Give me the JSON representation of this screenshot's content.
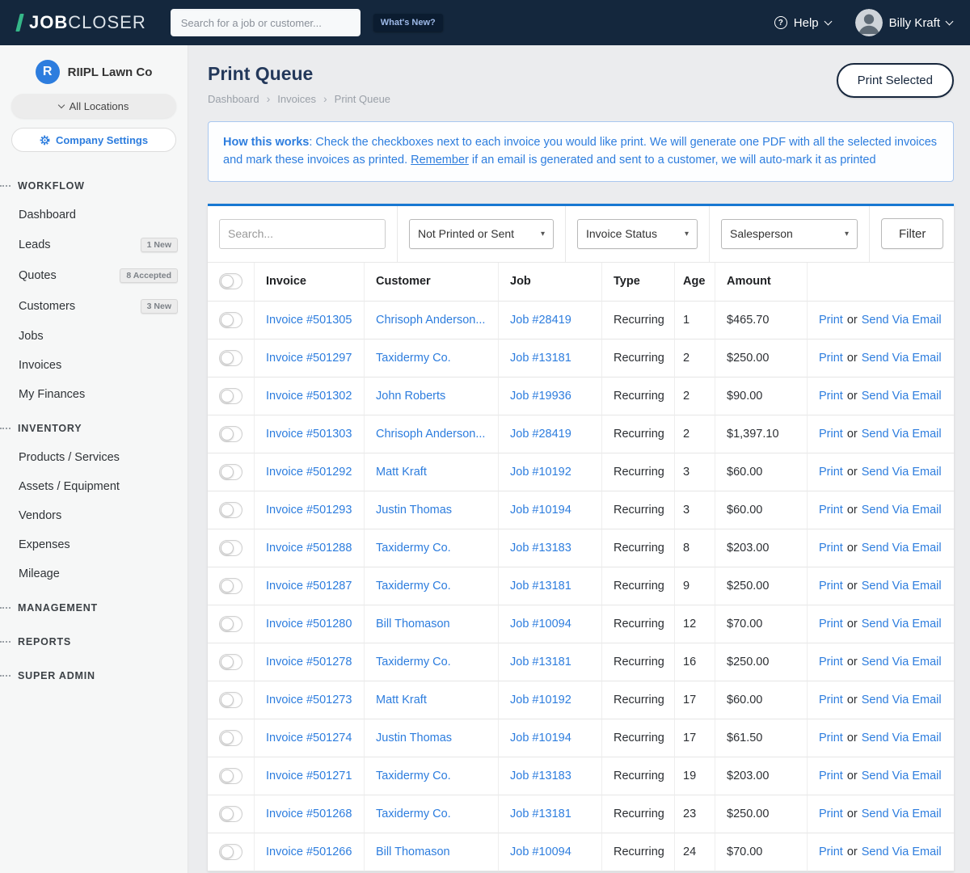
{
  "colors": {
    "brand_navy": "#14273d",
    "brand_teal": "#35b789",
    "link_blue": "#2d7dde"
  },
  "navbar": {
    "logo_bold": "JOB",
    "logo_light": "CLOSER",
    "search_placeholder": "Search for a job or customer...",
    "whats_new": "What's New?",
    "help_label": "Help",
    "user_name": "Billy Kraft"
  },
  "sidebar": {
    "company_initial": "R",
    "company_name": "RIIPL Lawn Co",
    "locations_label": "All Locations",
    "settings_label": "Company Settings",
    "sections": [
      {
        "title": "WORKFLOW",
        "items": [
          {
            "label": "Dashboard"
          },
          {
            "label": "Leads",
            "badge": "1 New"
          },
          {
            "label": "Quotes",
            "badge": "8 Accepted"
          },
          {
            "label": "Customers",
            "badge": "3 New"
          },
          {
            "label": "Jobs"
          },
          {
            "label": "Invoices"
          },
          {
            "label": "My Finances"
          }
        ]
      },
      {
        "title": "INVENTORY",
        "items": [
          {
            "label": "Products / Services"
          },
          {
            "label": "Assets / Equipment"
          },
          {
            "label": "Vendors"
          },
          {
            "label": "Expenses"
          },
          {
            "label": "Mileage"
          }
        ]
      },
      {
        "title": "MANAGEMENT",
        "items": []
      },
      {
        "title": "REPORTS",
        "items": []
      },
      {
        "title": "SUPER ADMIN",
        "items": []
      }
    ]
  },
  "page": {
    "title": "Print Queue",
    "breadcrumb": [
      "Dashboard",
      "Invoices",
      "Print Queue"
    ],
    "print_selected_label": "Print Selected",
    "info": {
      "lead": "How this works",
      "text1": ": Check the checkboxes next to each invoice you would like print. We will generate one PDF with all the selected invoices and mark these invoices as printed. ",
      "remember": "Remember",
      "text2": " if an email is generated and sent to a customer, we will auto-mark it as printed"
    }
  },
  "filters": {
    "search_placeholder": "Search...",
    "selects": [
      "Not Printed or Sent",
      "Invoice Status",
      "Salesperson"
    ],
    "filter_button": "Filter"
  },
  "table": {
    "headers": [
      "Invoice",
      "Customer",
      "Job",
      "Type",
      "Age",
      "Amount"
    ],
    "action_print": "Print",
    "action_or": "or",
    "action_email": "Send Via Email",
    "rows": [
      {
        "invoice": "Invoice #501305",
        "customer": "Chrisoph Anderson...",
        "job": "Job #28419",
        "type": "Recurring",
        "age": "1",
        "amount": "$465.70"
      },
      {
        "invoice": "Invoice #501297",
        "customer": "Taxidermy Co.",
        "job": "Job #13181",
        "type": "Recurring",
        "age": "2",
        "amount": "$250.00"
      },
      {
        "invoice": "Invoice #501302",
        "customer": "John Roberts",
        "job": "Job #19936",
        "type": "Recurring",
        "age": "2",
        "amount": "$90.00"
      },
      {
        "invoice": "Invoice #501303",
        "customer": "Chrisoph Anderson...",
        "job": "Job #28419",
        "type": "Recurring",
        "age": "2",
        "amount": "$1,397.10"
      },
      {
        "invoice": "Invoice #501292",
        "customer": "Matt Kraft",
        "job": "Job #10192",
        "type": "Recurring",
        "age": "3",
        "amount": "$60.00"
      },
      {
        "invoice": "Invoice #501293",
        "customer": "Justin Thomas",
        "job": "Job #10194",
        "type": "Recurring",
        "age": "3",
        "amount": "$60.00"
      },
      {
        "invoice": "Invoice #501288",
        "customer": "Taxidermy Co.",
        "job": "Job #13183",
        "type": "Recurring",
        "age": "8",
        "amount": "$203.00"
      },
      {
        "invoice": "Invoice #501287",
        "customer": "Taxidermy Co.",
        "job": "Job #13181",
        "type": "Recurring",
        "age": "9",
        "amount": "$250.00"
      },
      {
        "invoice": "Invoice #501280",
        "customer": "Bill Thomason",
        "job": "Job #10094",
        "type": "Recurring",
        "age": "12",
        "amount": "$70.00"
      },
      {
        "invoice": "Invoice #501278",
        "customer": "Taxidermy Co.",
        "job": "Job #13181",
        "type": "Recurring",
        "age": "16",
        "amount": "$250.00"
      },
      {
        "invoice": "Invoice #501273",
        "customer": "Matt Kraft",
        "job": "Job #10192",
        "type": "Recurring",
        "age": "17",
        "amount": "$60.00"
      },
      {
        "invoice": "Invoice #501274",
        "customer": "Justin Thomas",
        "job": "Job #10194",
        "type": "Recurring",
        "age": "17",
        "amount": "$61.50"
      },
      {
        "invoice": "Invoice #501271",
        "customer": "Taxidermy Co.",
        "job": "Job #13183",
        "type": "Recurring",
        "age": "19",
        "amount": "$203.00"
      },
      {
        "invoice": "Invoice #501268",
        "customer": "Taxidermy Co.",
        "job": "Job #13181",
        "type": "Recurring",
        "age": "23",
        "amount": "$250.00"
      },
      {
        "invoice": "Invoice #501266",
        "customer": "Bill Thomason",
        "job": "Job #10094",
        "type": "Recurring",
        "age": "24",
        "amount": "$70.00"
      }
    ]
  }
}
